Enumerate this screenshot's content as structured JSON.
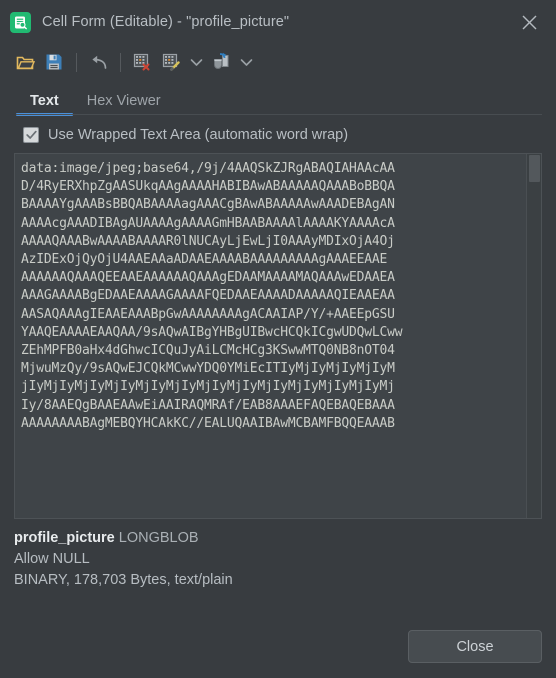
{
  "window": {
    "title": "Cell Form (Editable) - \"profile_picture\"",
    "icon": "cell-form-icon",
    "close_icon": "close-icon"
  },
  "toolbar": {
    "items": [
      {
        "name": "open-file-button",
        "icon": "open-folder-icon",
        "label": ""
      },
      {
        "name": "save-file-button",
        "icon": "save-floppy-icon",
        "label": ""
      },
      {
        "name": "undo-button",
        "icon": "undo-arrow-icon",
        "label": ""
      },
      {
        "name": "set-null-button",
        "icon": "grid-delete-icon",
        "label": ""
      },
      {
        "name": "apply-data-button",
        "icon": "grid-edit-icon",
        "label": ""
      },
      {
        "name": "apply-dropdown-button",
        "icon": "chevron-down-icon",
        "label": ""
      },
      {
        "name": "import-data-button",
        "icon": "pour-data-icon",
        "label": ""
      },
      {
        "name": "import-dropdown-button",
        "icon": "chevron-down-icon",
        "label": ""
      }
    ]
  },
  "tabs": [
    {
      "label": "Text",
      "active": true
    },
    {
      "label": "Hex Viewer",
      "active": false
    }
  ],
  "wrap_option": {
    "label": "Use Wrapped Text Area (automatic word wrap)",
    "checked": true
  },
  "editor": {
    "lines": [
      "data:image/jpeg;base64,/9j/4AAQSkZJRgABAQIAHAAcAA",
      "D/4RyERXhpZgAASUkqAAgAAAAHABIBAwABAAAAAQAAABoBBQA",
      "BAAAAYgAAABsBBQABAAAAagAAACgBAwABAAAAAwAAADEBAgAN",
      "AAAAcgAAADIBAgAUAAAAgAAAAGmHBAABAAAAlAAAAKYAAAAcA",
      "AAAAQAAABwAAAABAAAAR0lNUCAyLjEwLjI0AAAyMDIxOjA4Oj",
      "AzIDExOjQyOjU4AAEAAaADAAEAAAABAAAAAAAAAgAAAEEAAE",
      "AAAAAAQAAAQEEAAEAAAAAAQAAAgEDAAMAAAAMAQAAAwEDAAEA",
      "AAAGAAAABgEDAAEAAAAGAAAAFQEDAAEAAAADAAAAAQIEAAEAA",
      "AASAQAAAgIEAAEAAABpGwAAAAAAAAgACAAIAP/Y/+AAEEpGSU",
      "YAAQEAAAAEAAQAA/9sAQwAIBgYHBgUIBwcHCQkICgwUDQwLCww",
      "ZEhMPFB0aHx4dGhwcICQuJyAiLCMcHCg3KSwwMTQ0NB8nOT04",
      "MjwuMzQy/9sAQwEJCQkMCwwYDQ0YMiEcITIyMjIyMjIyMjIyM",
      "jIyMjIyMjIyMjIyMjIyMjIyMjIyMjIyMjIyMjIyMjIyMjIyMj",
      "Iy/8AAEQgBAAEAAwEiAAIRAQMRAf/EAB8AAAEFAQEBAQEBAAA",
      "AAAAAAAABAgMEBQYHCAkKC//EALUQAAIBAwMCBAMFBQQEAAAB"
    ]
  },
  "info": {
    "column_name": "profile_picture",
    "column_type": "LONGBLOB",
    "nullable": "Allow NULL",
    "details": "BINARY, 178,703 Bytes, text/plain"
  },
  "footer": {
    "close_label": "Close"
  },
  "colors": {
    "window_bg": "#383c40",
    "editor_bg": "#3f4448",
    "accent": "#4a90d9",
    "icon_green": "#21ba72",
    "text": "#b9bfc4"
  }
}
